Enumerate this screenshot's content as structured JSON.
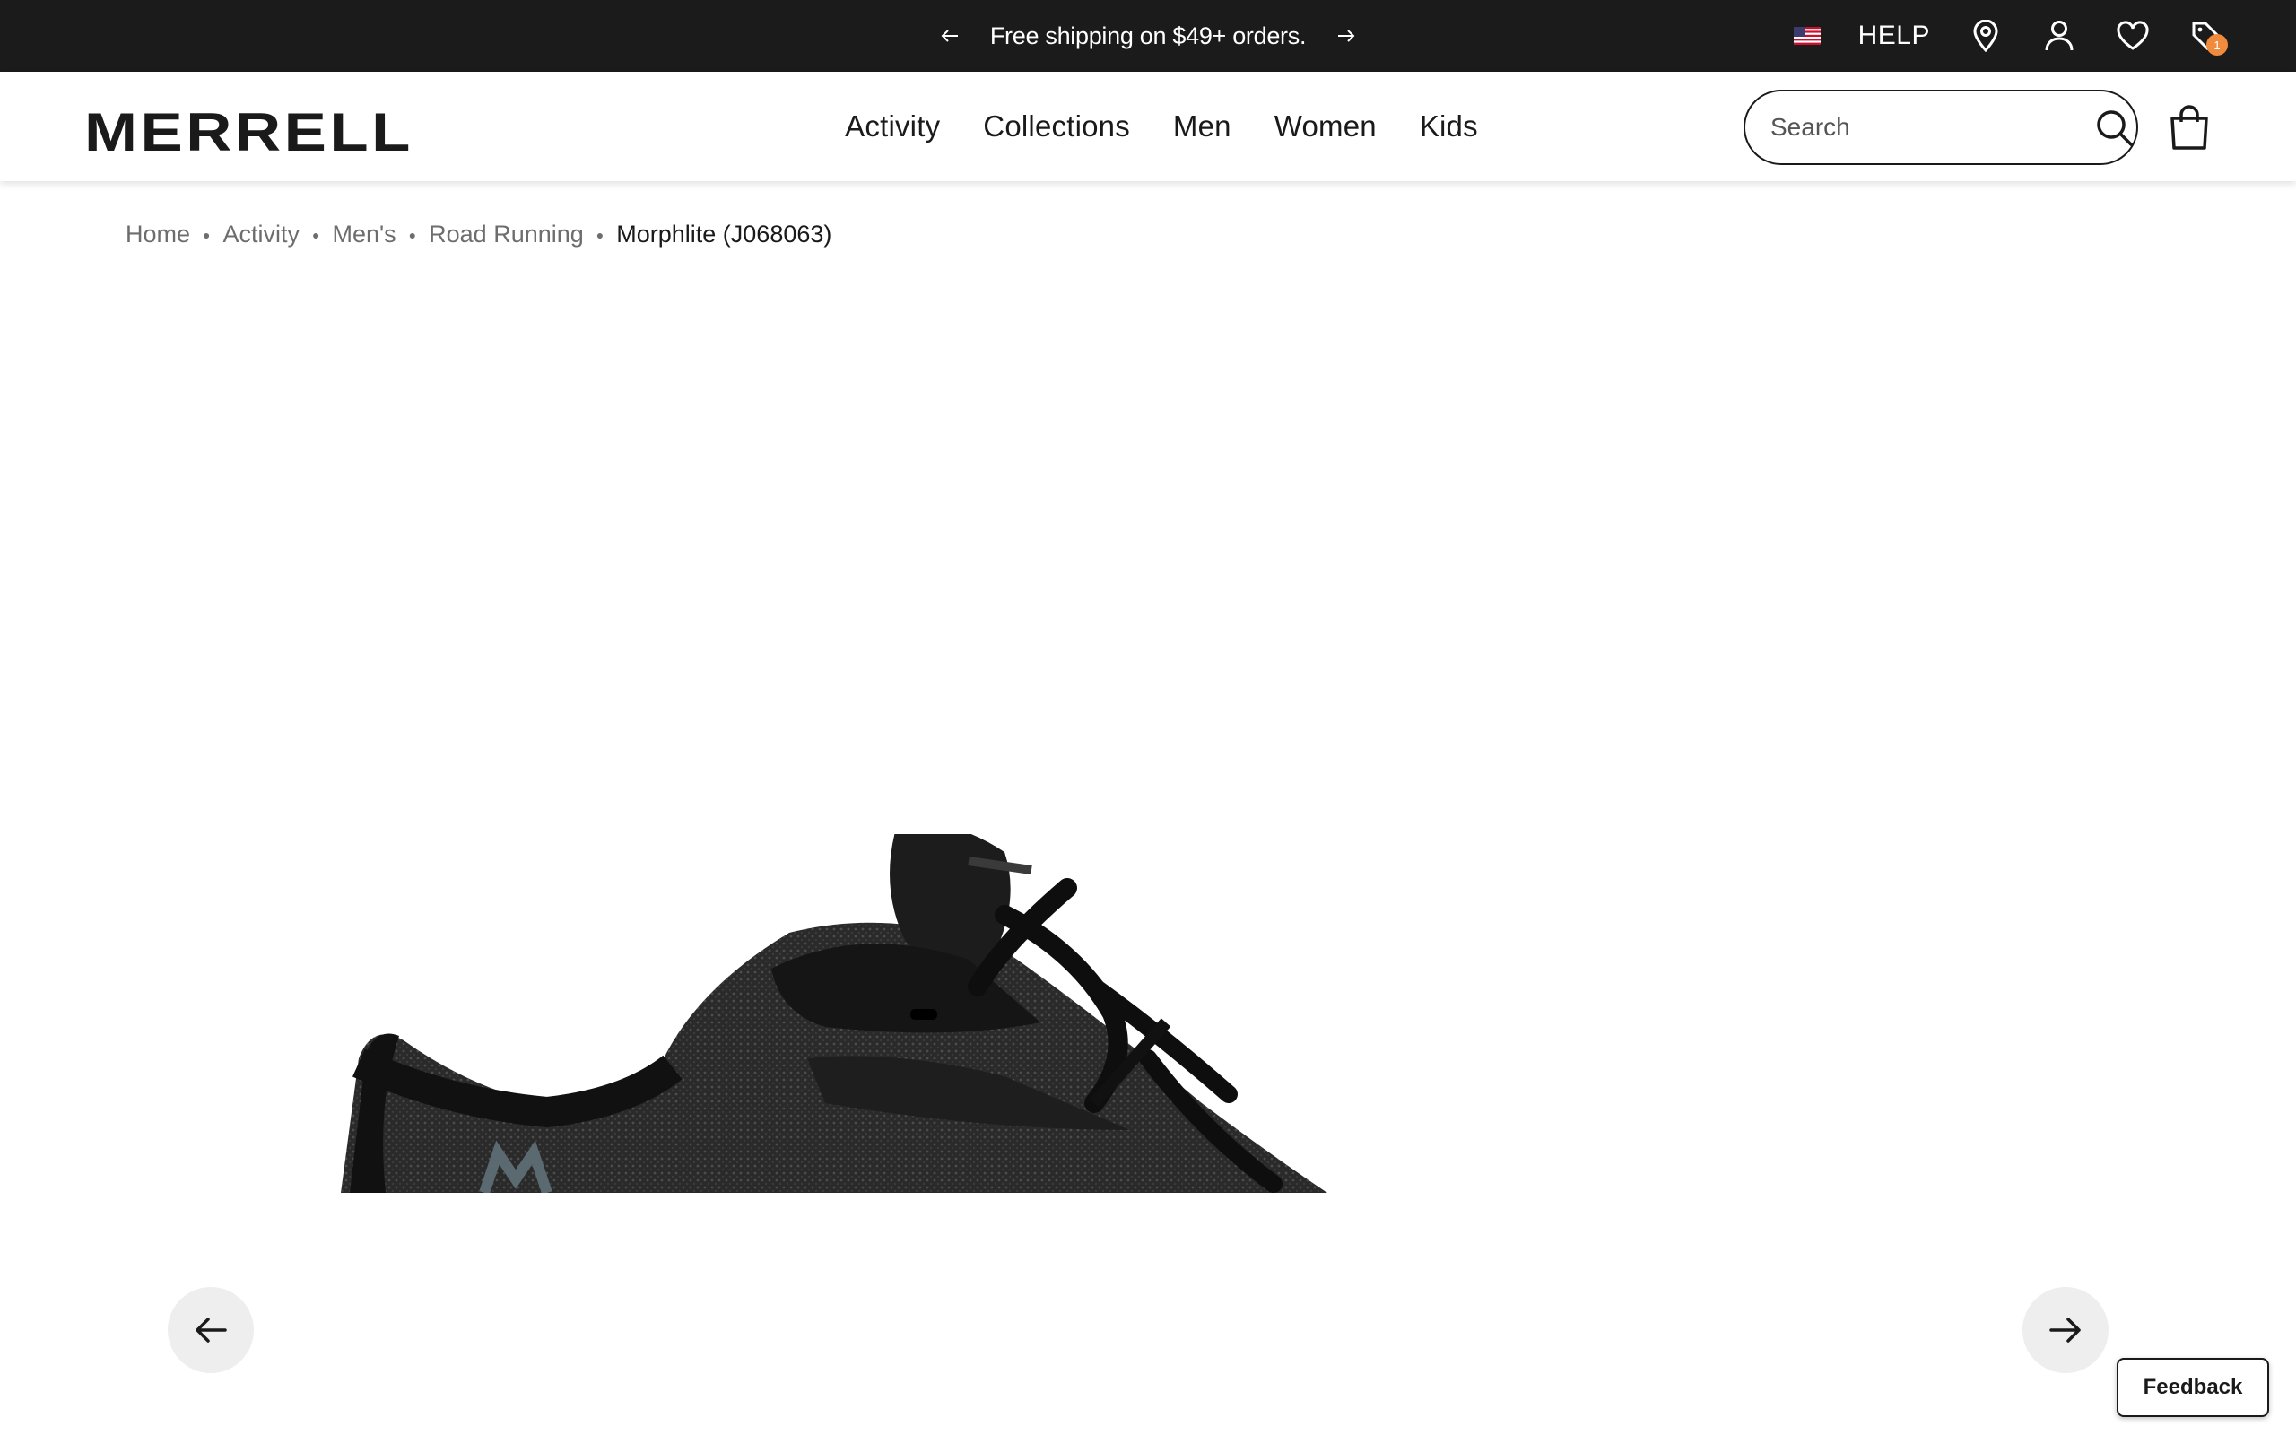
{
  "promo": {
    "message": "Free shipping on $49+ orders.",
    "prev_icon": "arrow-left-icon",
    "next_icon": "arrow-right-icon"
  },
  "utility": {
    "flag_icon": "us-flag-icon",
    "help_label": "HELP",
    "icons": [
      "location-pin-icon",
      "account-icon",
      "wishlist-heart-icon",
      "tag-icon"
    ],
    "tag_badge_count": "1"
  },
  "header": {
    "logo_text": "MERRELL",
    "nav": [
      "Activity",
      "Collections",
      "Men",
      "Women",
      "Kids"
    ],
    "search_placeholder": "Search",
    "bag_icon": "shopping-bag-icon"
  },
  "breadcrumb": {
    "items": [
      "Home",
      "Activity",
      "Men's",
      "Road Running"
    ],
    "current": "Morphlite (J068063)"
  },
  "gallery": {
    "prev_icon": "arrow-left-icon",
    "next_icon": "arrow-right-icon"
  },
  "feedback_label": "Feedback",
  "colors": {
    "promo_bg": "#1b1b1b",
    "badge": "#f08a3c",
    "text": "#1a1a1a",
    "breadcrumb": "#6d6d6d",
    "gallery_button": "#eeeeee"
  }
}
